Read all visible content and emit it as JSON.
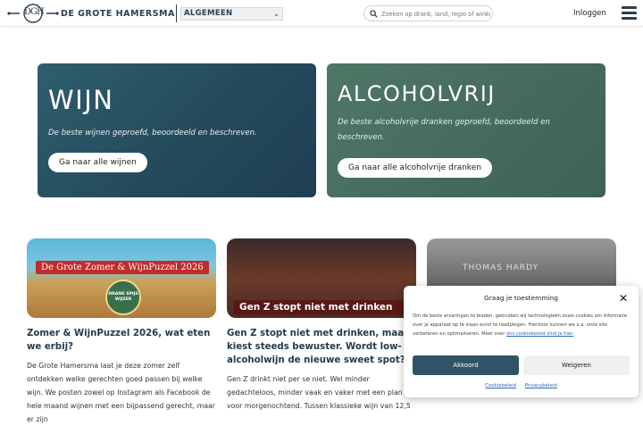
{
  "header": {
    "logo_text": "DE GROTE HAMERSMA",
    "logo_monogram": "DGH",
    "category_select": "ALGEMEEN",
    "search_placeholder": "Zoeken op drank, land, regio of winkel",
    "login_label": "Inloggen"
  },
  "hero": [
    {
      "title": "WIJN",
      "description": "De beste wijnen geproefd, beoordeeld en beschreven.",
      "button": "Ga naar alle wijnen"
    },
    {
      "title": "ALCOHOLVRIJ",
      "description": "De beste alcoholvrije dranken geproefd, beoordeeld en beschreven.",
      "button": "Ga naar alle alcoholvrije dranken"
    }
  ],
  "articles": [
    {
      "image_banner": "De Grote Zomer & WijnPuzzel 2026",
      "image_badge": "DRANK SPIJS WIJZER",
      "title": "Zomer & WijnPuzzel 2026, wat eten we erbij?",
      "excerpt": "De Grote Hamersma laat je deze zomer zelf ontdekken welke gerechten goed passen bij welke wijn. We posten zowel op Instagram als Facebook de hele maand wijnen met een bijpassend gerecht, maar er zijn"
    },
    {
      "image_caption": "Gen Z stopt niet met drinken",
      "title": "Gen Z stopt niet met drinken, maar kiest steeds bewuster. Wordt low-alcoholwijn de nieuwe sweet spot?",
      "excerpt": "Gen Z drinkt niet per se niet. Wel minder gedachteloos, minder vaak en vaker met een plan voor morgenochtend. Tussen klassieke wijn van 12,5"
    },
    {
      "image_sign": "THOMAS HARDY"
    }
  ],
  "consent": {
    "title": "Graag je toestemming",
    "text": "Om de beste ervaringen te bieden, gebruiken wij technologieën zoals cookies om informatie over je apparaat op te slaan en/of te raadplegen. Hierdoor kunnen we o.a. onze site verbeteren en optimaliseren. Meer over",
    "text_link": "ons cookiebeleid vind je hier.",
    "accept": "Akkoord",
    "deny": "Weigeren",
    "link_cookie": "Cookiebeleid",
    "link_privacy": "Privacybeleid"
  },
  "colors": {
    "brand_dark": "#2d3e4e",
    "wine_card": "#244a5b",
    "nonalc_card": "#456b5e",
    "accept_button": "#2f5466"
  }
}
